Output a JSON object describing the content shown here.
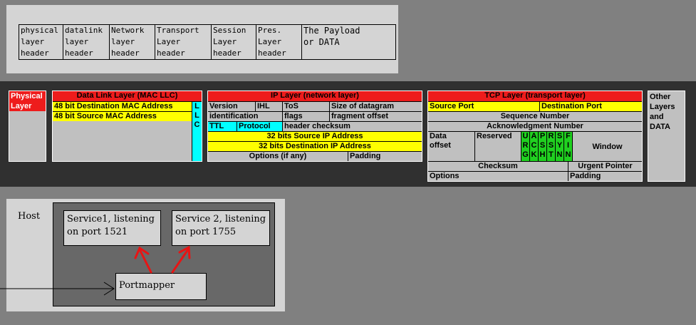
{
  "osi_stack": {
    "cells": [
      {
        "lines": [
          "physical",
          "layer",
          "header"
        ]
      },
      {
        "lines": [
          "datalink",
          "layer",
          "header"
        ]
      },
      {
        "lines": [
          "Network",
          "layer",
          "header"
        ]
      },
      {
        "lines": [
          "Transport",
          "Layer",
          "header"
        ]
      },
      {
        "lines": [
          "Session",
          "Layer",
          "header"
        ]
      },
      {
        "lines": [
          "Pres.",
          "Layer",
          "header"
        ]
      },
      {
        "lines": [
          "The Payload",
          "or DATA"
        ]
      }
    ]
  },
  "frame": {
    "physical": {
      "line1": "Physical",
      "line2": "Layer"
    },
    "datalink": {
      "title": "Data Link Layer (MAC LLC)",
      "dest_mac": "48 bit Destination MAC Address",
      "src_mac": "48 bit Source MAC Address",
      "llc": [
        "L",
        "L",
        "C"
      ]
    },
    "ip": {
      "title": "IP Layer  (network layer)",
      "version": "Version",
      "ihl": "IHL",
      "tos": "ToS",
      "size": "Size of datagram",
      "identification": "identification",
      "flags": "flags",
      "fragment_offset": "fragment offset",
      "ttl": "TTL",
      "protocol": "Protocol",
      "header_checksum": "header checksum",
      "src_ip": "32 bits Source IP Address",
      "dst_ip": "32 bits Destination IP Address",
      "options": "Options (if any)",
      "padding": "Padding"
    },
    "tcp": {
      "title": "TCP Layer  (transport layer)",
      "src_port": "Source Port",
      "dst_port": "Destination Port",
      "seq": "Sequence Number",
      "ack": "Acknowledgment Number",
      "data_offset": [
        "Data",
        "offset"
      ],
      "reserved": "Reserved",
      "flags": [
        {
          "letters": [
            "U",
            "R",
            "G"
          ]
        },
        {
          "letters": [
            "A",
            "C",
            "K"
          ]
        },
        {
          "letters": [
            "P",
            "S",
            "H"
          ]
        },
        {
          "letters": [
            "R",
            "S",
            "T"
          ]
        },
        {
          "letters": [
            "S",
            "Y",
            "N"
          ]
        },
        {
          "letters": [
            "F",
            "I",
            "N"
          ]
        }
      ],
      "window": "Window",
      "checksum": "Checksum",
      "urgent_pointer": "Urgent Pointer",
      "options": "Options",
      "padding": "Padding"
    },
    "other": [
      "Other",
      "Layers",
      "and",
      "DATA"
    ]
  },
  "host": {
    "label": "Host",
    "service1": [
      "Service1, listening",
      "on port 1521"
    ],
    "service2": [
      "Service 2, listening",
      "on port 1755"
    ],
    "portmapper": "Portmapper"
  },
  "colors": {
    "header_red": "#ee1c1c",
    "field_yellow": "#ffff00",
    "field_cyan": "#00ffff",
    "flag_green": "#20d020",
    "arrow_red": "#e81414"
  }
}
